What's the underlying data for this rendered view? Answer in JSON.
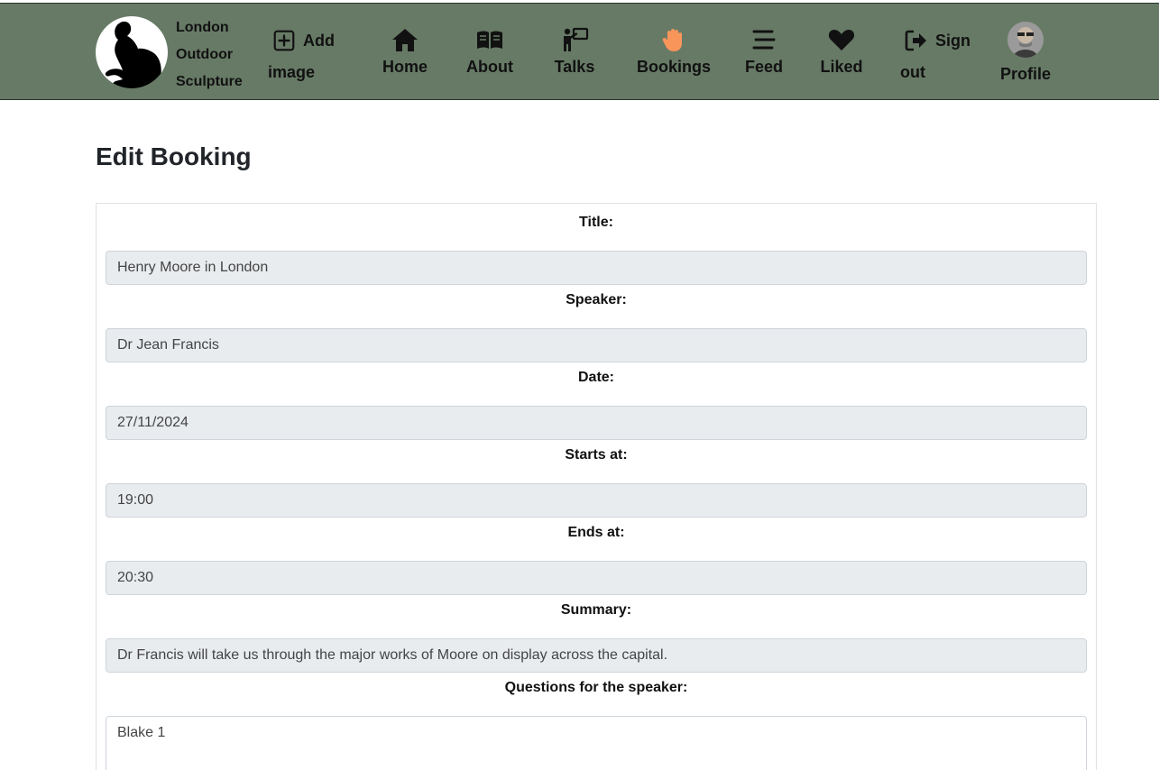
{
  "nav": {
    "brand": [
      "London",
      "Outdoor",
      "Sculpture"
    ],
    "add_image": {
      "word1": "Add",
      "word2": "image",
      "icon": "plus-square-icon"
    },
    "home": {
      "label": "Home",
      "icon": "home-icon"
    },
    "about": {
      "label": "About",
      "icon": "book-open-icon"
    },
    "talks": {
      "label": "Talks",
      "icon": "presenter-icon"
    },
    "bookings": {
      "label": "Bookings",
      "icon": "hand-icon",
      "icon_color": "#f7955a"
    },
    "feed": {
      "label": "Feed",
      "icon": "stream-icon"
    },
    "liked": {
      "label": "Liked",
      "icon": "heart-icon"
    },
    "signout": {
      "word1": "Sign",
      "word2": "out",
      "icon": "sign-out-icon"
    },
    "profile": {
      "label": "Profile",
      "icon": "avatar"
    }
  },
  "page": {
    "title": "Edit Booking"
  },
  "form": {
    "fields": [
      {
        "label": "Title:",
        "value": "Henry Moore in London"
      },
      {
        "label": "Speaker:",
        "value": "Dr Jean Francis"
      },
      {
        "label": "Date:",
        "value": "27/11/2024"
      },
      {
        "label": "Starts at:",
        "value": "19:00"
      },
      {
        "label": "Ends at:",
        "value": "20:30"
      },
      {
        "label": "Summary:",
        "value": "Dr Francis will take us through the major works of Moore on display across the capital."
      },
      {
        "label": "Questions for the speaker:",
        "value": "Blake 1"
      }
    ]
  },
  "colors": {
    "navbar_bg": "#677a66",
    "input_bg": "#e9ecef",
    "accent_hand": "#f7955a"
  }
}
